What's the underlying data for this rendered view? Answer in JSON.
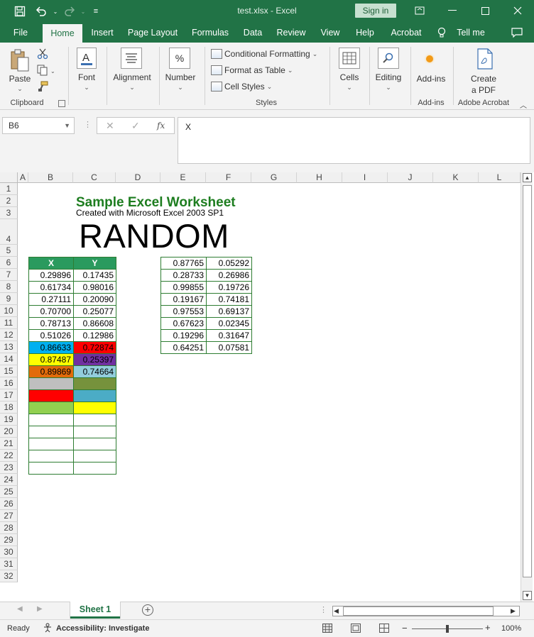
{
  "window": {
    "title": "test.xlsx  -  Excel",
    "sign_in": "Sign in"
  },
  "menu_tabs": [
    "File",
    "Home",
    "Insert",
    "Page Layout",
    "Formulas",
    "Data",
    "Review",
    "View",
    "Help",
    "Acrobat",
    "Tell me"
  ],
  "ribbon": {
    "paste": "Paste",
    "clipboard": "Clipboard",
    "font": "Font",
    "alignment": "Alignment",
    "number": "Number",
    "conditional_formatting": "Conditional Formatting",
    "format_as_table": "Format as Table",
    "cell_styles": "Cell Styles",
    "styles": "Styles",
    "cells": "Cells",
    "editing": "Editing",
    "add_ins": "Add-ins",
    "add_ins_group": "Add-ins",
    "create_pdf_line1": "Create",
    "create_pdf_line2": "a PDF",
    "adobe_acrobat": "Adobe Acrobat"
  },
  "formula_bar": {
    "name_box": "B6",
    "fx": "fx",
    "content": "X"
  },
  "columns": [
    "A",
    "B",
    "C",
    "D",
    "E",
    "F",
    "G",
    "H",
    "I",
    "J",
    "K",
    "L"
  ],
  "rows": [
    "1",
    "2",
    "3",
    "4",
    "5",
    "6",
    "7",
    "8",
    "9",
    "10",
    "11",
    "12",
    "13",
    "14",
    "15",
    "16",
    "17",
    "18",
    "19",
    "20",
    "21",
    "22",
    "23",
    "24",
    "25",
    "26",
    "27",
    "28",
    "29",
    "30",
    "31",
    "32"
  ],
  "sheet": {
    "title": "Sample Excel Worksheet",
    "subtitle": "Created with Microsoft Excel 2003 SP1",
    "random": "RANDOM",
    "table1": {
      "headers": [
        "X",
        "Y"
      ],
      "rows": [
        [
          "0.29896",
          "0.17435"
        ],
        [
          "0.61734",
          "0.98016"
        ],
        [
          "0.27111",
          "0.20090"
        ],
        [
          "0.70700",
          "0.25077"
        ],
        [
          "0.78713",
          "0.86608"
        ],
        [
          "0.51026",
          "0.12986"
        ],
        [
          "0.86633",
          "0.72874"
        ],
        [
          "0.87487",
          "0.25397"
        ],
        [
          "0.89869",
          "0.74664"
        ],
        [
          "",
          ""
        ],
        [
          "",
          ""
        ],
        [
          "",
          ""
        ],
        [
          "",
          ""
        ],
        [
          "",
          ""
        ],
        [
          "",
          ""
        ],
        [
          "",
          ""
        ],
        [
          "",
          ""
        ]
      ]
    },
    "table2": {
      "rows": [
        [
          "0.87765",
          "0.05292"
        ],
        [
          "0.28733",
          "0.26986"
        ],
        [
          "0.99855",
          "0.19726"
        ],
        [
          "0.19167",
          "0.74181"
        ],
        [
          "0.97553",
          "0.69137"
        ],
        [
          "0.67623",
          "0.02345"
        ],
        [
          "0.19296",
          "0.31647"
        ],
        [
          "0.64251",
          "0.07581"
        ]
      ]
    },
    "cell_colors": {
      "header": "#2a9a5e",
      "r13_x": "#00b0f0",
      "r13_y": "#ff0000",
      "r14_x": "#ffff00",
      "r14_y": "#7030a0",
      "r15_x": "#e26b0a",
      "r15_y": "#92cddc",
      "r16_x": "#bfbfbf",
      "r16_y": "#76923c",
      "r17_x": "#ff0000",
      "r17_y": "#4bacc6",
      "r18_x": "#92d050",
      "r18_y": "#ffff00"
    }
  },
  "sheet_tabs": [
    "Sheet 1"
  ],
  "status": {
    "ready": "Ready",
    "accessibility": "Accessibility: Investigate",
    "zoom": "100%"
  }
}
